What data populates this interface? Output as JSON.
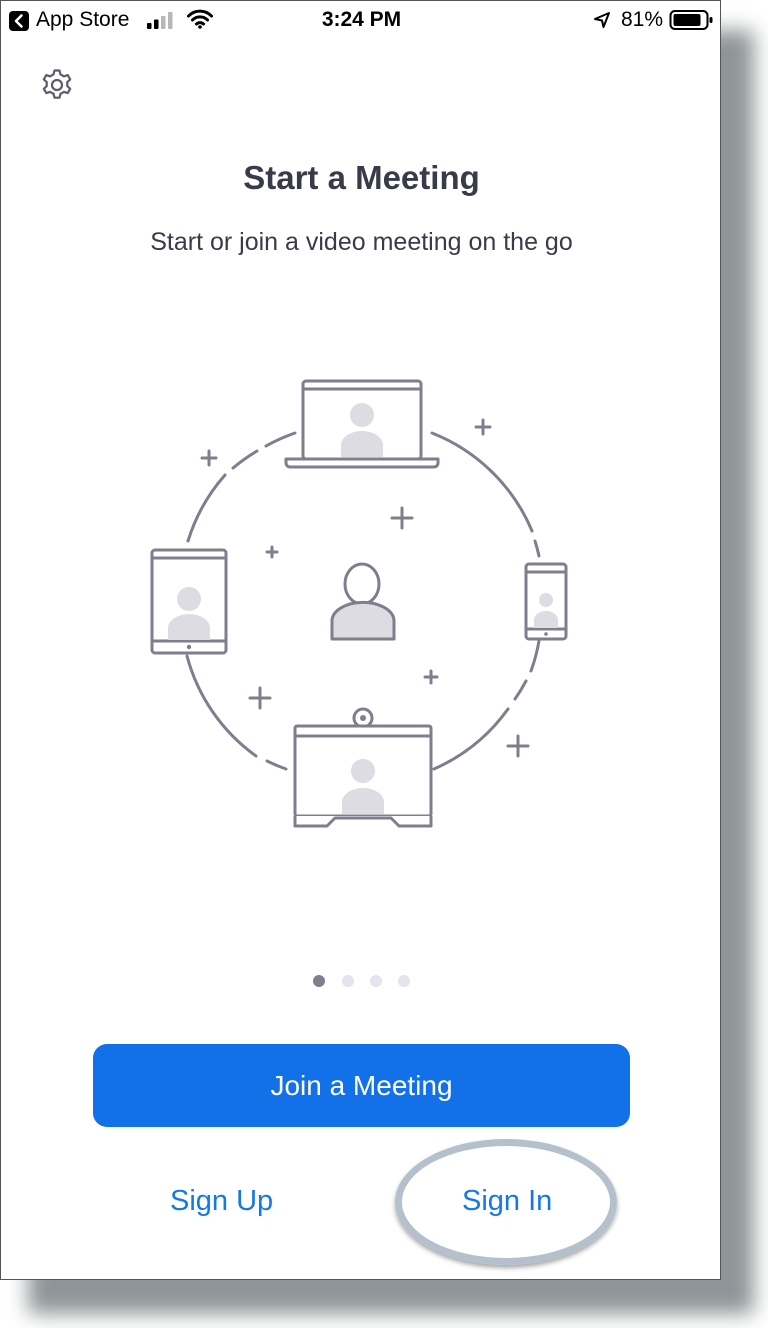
{
  "status_bar": {
    "back_app": "App Store",
    "time": "3:24 PM",
    "battery": "81%"
  },
  "icons": {
    "settings": "gear-icon",
    "back": "chevron-left-icon",
    "signal": "cellular-signal-icon",
    "wifi": "wifi-icon",
    "location": "location-arrow-icon",
    "battery": "battery-icon"
  },
  "onboarding": {
    "title": "Start a Meeting",
    "subtitle": "Start or join a video meeting on the go",
    "page_count": 4,
    "current_page": 1
  },
  "actions": {
    "join_meeting": "Join a Meeting",
    "sign_up": "Sign Up",
    "sign_in": "Sign In"
  },
  "colors": {
    "primary": "#1271e8",
    "link": "#1479e8",
    "text": "#3a3b4a",
    "illustration": "#7d7e8e",
    "highlight": "#b4c1cc"
  }
}
